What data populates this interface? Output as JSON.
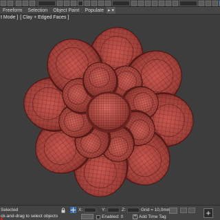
{
  "ribbon": {
    "tabs": [
      "Freeform",
      "Selection",
      "Object Paint",
      "Populate"
    ],
    "overflow_label": "▸ ▾"
  },
  "viewport": {
    "label_prefix": "[",
    "label_mode": "t Mode ]",
    "label_shading": "[ Clay + Edged Faces ]"
  },
  "status": {
    "selection": "Selected",
    "hint": "ck-and-drag to select objects",
    "x_label": "X:",
    "y_label": "Y:",
    "z_label": "Z:",
    "grid": "Grid = 10,0mm",
    "enabled_label": "Enabled:",
    "enabled_value": "0",
    "add_time_tag": "Add Time Tag",
    "add_button": "+"
  },
  "colors": {
    "model": "#9a3a33",
    "model_light": "#c0544c",
    "wire": "#3a0f0c",
    "viewport_bg": "#3d3d3d"
  }
}
